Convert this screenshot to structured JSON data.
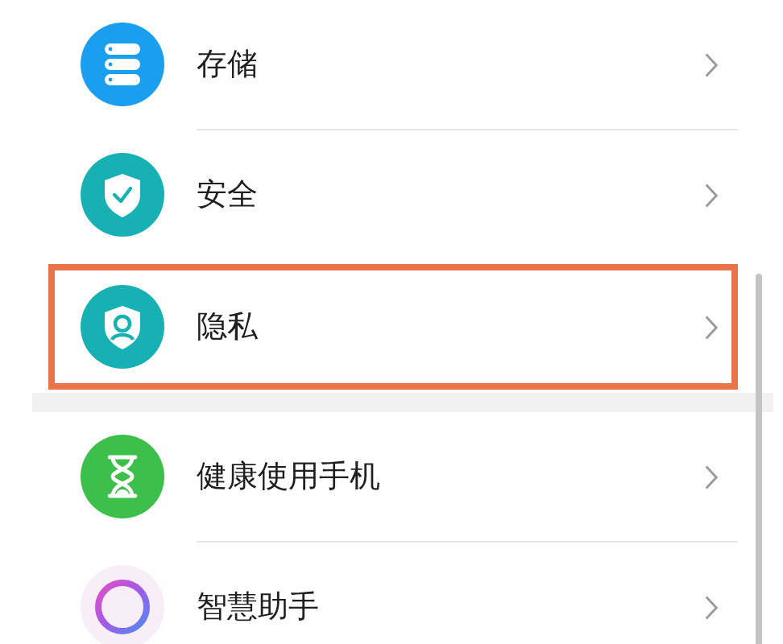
{
  "groups": [
    {
      "items": [
        {
          "kind": "storage",
          "label": "存储",
          "highlighted": false
        },
        {
          "kind": "security",
          "label": "安全",
          "highlighted": false
        },
        {
          "kind": "privacy",
          "label": "隐私",
          "highlighted": true
        }
      ]
    },
    {
      "items": [
        {
          "kind": "health",
          "label": "健康使用手机",
          "highlighted": false
        },
        {
          "kind": "assistant",
          "label": "智慧助手",
          "highlighted": false
        }
      ]
    }
  ]
}
